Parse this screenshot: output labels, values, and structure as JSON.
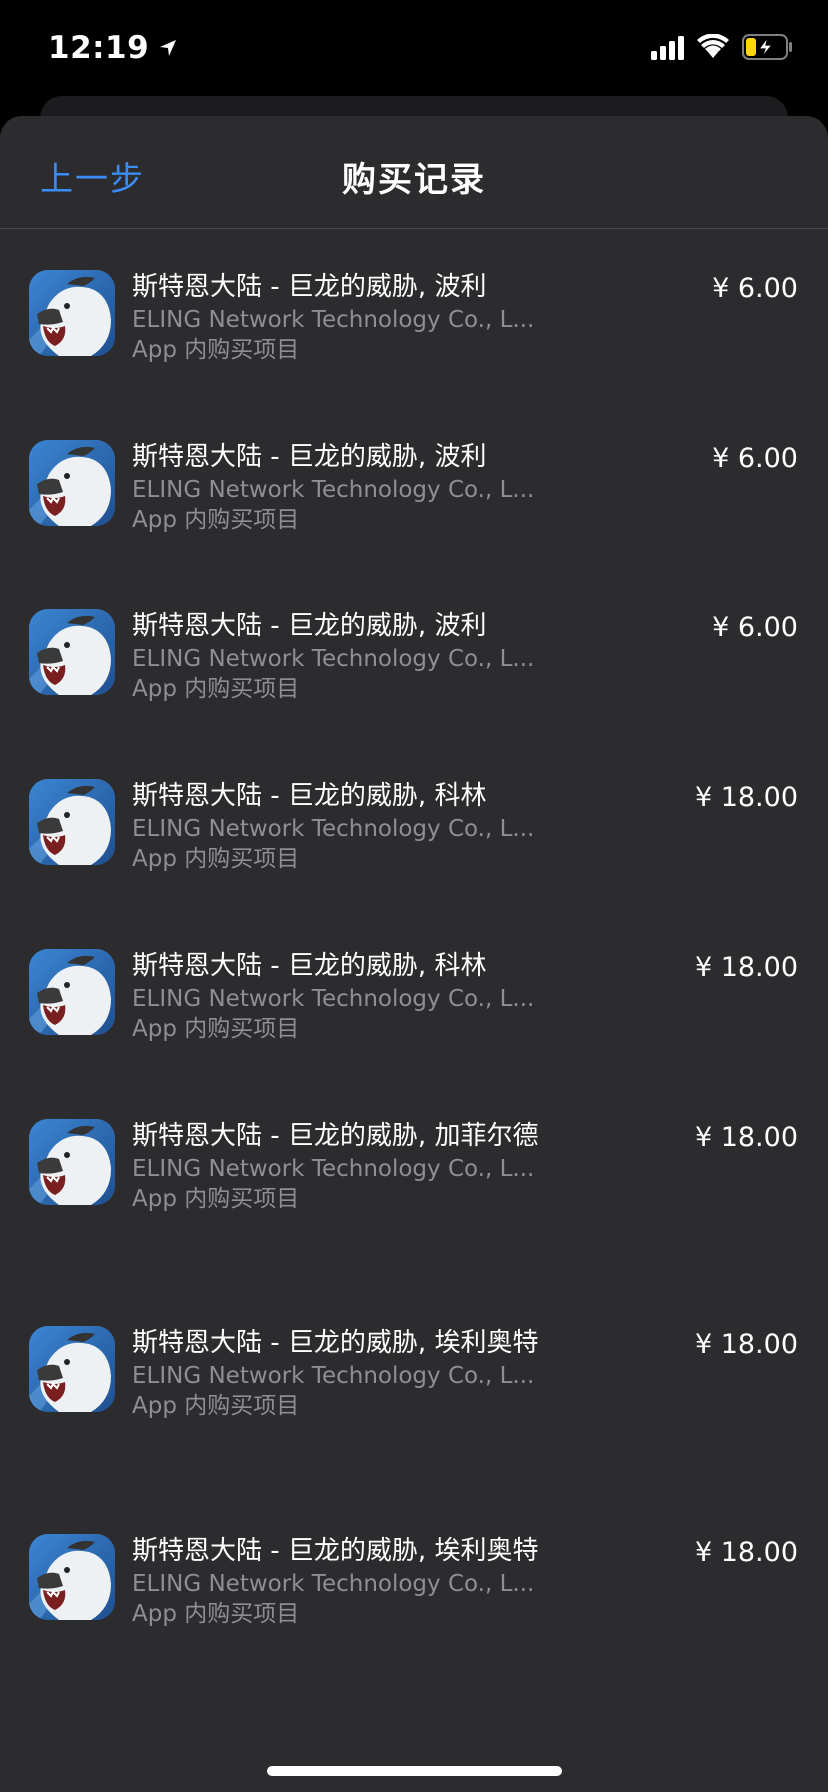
{
  "status_bar": {
    "time": "12:19"
  },
  "nav": {
    "back_label": "上一步",
    "title": "购买记录"
  },
  "purchases": [
    {
      "title": "斯特恩大陆 - 巨龙的威胁, 波利",
      "developer": "ELING Network Technology Co., L...",
      "kind": "App 内购买项目",
      "price": "¥ 6.00"
    },
    {
      "title": "斯特恩大陆 - 巨龙的威胁, 波利",
      "developer": "ELING Network Technology Co., L...",
      "kind": "App 内购买项目",
      "price": "¥ 6.00"
    },
    {
      "title": "斯特恩大陆 - 巨龙的威胁, 波利",
      "developer": "ELING Network Technology Co., L...",
      "kind": "App 内购买项目",
      "price": "¥ 6.00"
    },
    {
      "title": "斯特恩大陆 - 巨龙的威胁, 科林",
      "developer": "ELING Network Technology Co., L...",
      "kind": "App 内购买项目",
      "price": "¥ 18.00"
    },
    {
      "title": "斯特恩大陆 - 巨龙的威胁, 科林",
      "developer": "ELING Network Technology Co., L...",
      "kind": "App 内购买项目",
      "price": "¥ 18.00"
    },
    {
      "title": "斯特恩大陆 - 巨龙的威胁, 加菲尔德",
      "developer": "ELING Network Technology Co., L...",
      "kind": "App 内购买项目",
      "price": "¥ 18.00"
    },
    {
      "title": "斯特恩大陆 - 巨龙的威胁, 埃利奥特",
      "developer": "ELING Network Technology Co., L...",
      "kind": "App 内购买项目",
      "price": "¥ 18.00"
    },
    {
      "title": "斯特恩大陆 - 巨龙的威胁, 埃利奥特",
      "developer": "ELING Network Technology Co., L...",
      "kind": "App 内购买项目",
      "price": "¥ 18.00"
    }
  ],
  "colors": {
    "accent": "#3a8cf6",
    "sheet": "#2c2c2e",
    "secondary_text": "#8e8e93"
  },
  "icons": {
    "app": "polar-bear-app-icon",
    "location": "location-arrow-icon",
    "signal": "cellular-signal-icon",
    "wifi": "wifi-icon",
    "battery": "battery-charging-icon"
  }
}
